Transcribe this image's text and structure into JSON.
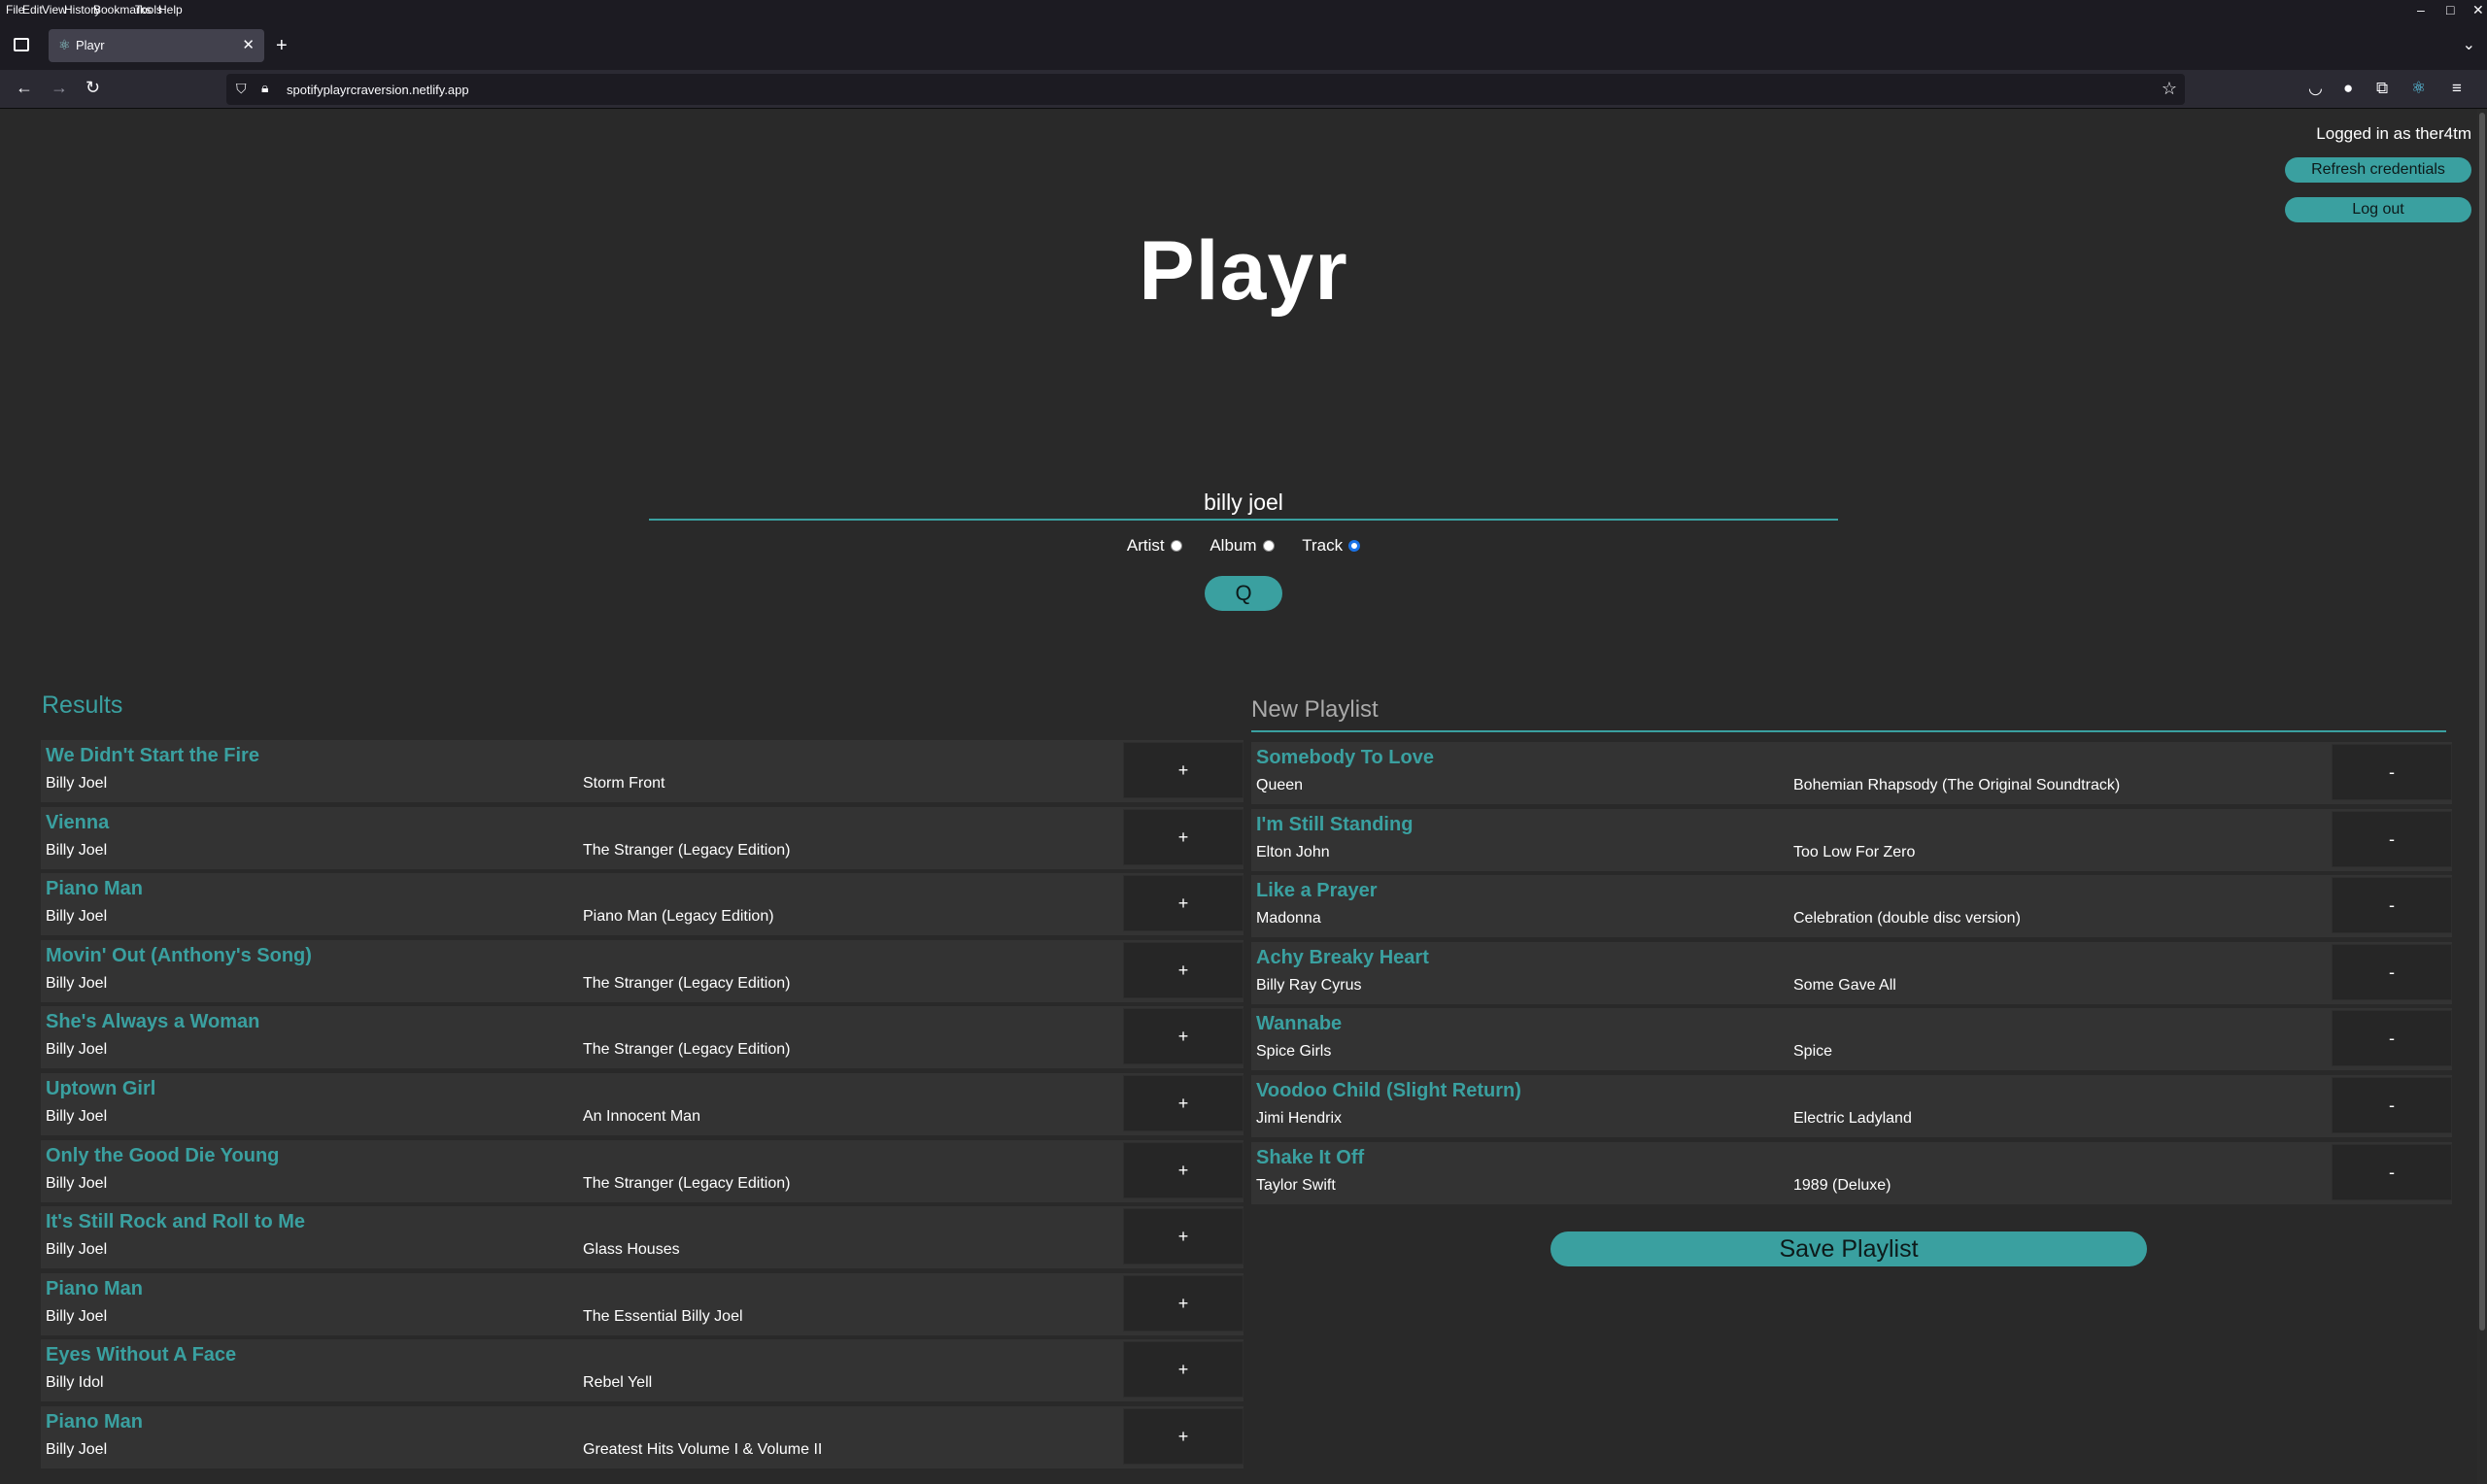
{
  "browser": {
    "menus": [
      "File",
      "Edit",
      "View",
      "History",
      "Bookmarks",
      "Tools",
      "Help"
    ],
    "tab_title": "Playr",
    "url": "spotifyplayrcraversion.netlify.app"
  },
  "header": {
    "logged_in_text": "Logged in as ther4tm",
    "refresh_label": "Refresh credentials",
    "logout_label": "Log out",
    "app_title": "Playr"
  },
  "search": {
    "value": "billy joel",
    "options": [
      {
        "label": "Artist",
        "checked": false
      },
      {
        "label": "Album",
        "checked": false
      },
      {
        "label": "Track",
        "checked": true
      }
    ],
    "button_label": "Q"
  },
  "results": {
    "title": "Results",
    "add_label": "+",
    "tracks": [
      {
        "name": "We Didn't Start the Fire",
        "artist": "Billy Joel",
        "album": "Storm Front"
      },
      {
        "name": "Vienna",
        "artist": "Billy Joel",
        "album": "The Stranger (Legacy Edition)"
      },
      {
        "name": "Piano Man",
        "artist": "Billy Joel",
        "album": "Piano Man (Legacy Edition)"
      },
      {
        "name": "Movin' Out (Anthony's Song)",
        "artist": "Billy Joel",
        "album": "The Stranger (Legacy Edition)"
      },
      {
        "name": "She's Always a Woman",
        "artist": "Billy Joel",
        "album": "The Stranger (Legacy Edition)"
      },
      {
        "name": "Uptown Girl",
        "artist": "Billy Joel",
        "album": "An Innocent Man"
      },
      {
        "name": "Only the Good Die Young",
        "artist": "Billy Joel",
        "album": "The Stranger (Legacy Edition)"
      },
      {
        "name": "It's Still Rock and Roll to Me",
        "artist": "Billy Joel",
        "album": "Glass Houses"
      },
      {
        "name": "Piano Man",
        "artist": "Billy Joel",
        "album": "The Essential Billy Joel"
      },
      {
        "name": "Eyes Without A Face",
        "artist": "Billy Idol",
        "album": "Rebel Yell"
      },
      {
        "name": "Piano Man",
        "artist": "Billy Joel",
        "album": "Greatest Hits Volume I & Volume II"
      }
    ]
  },
  "playlist": {
    "name_value": "New Playlist",
    "remove_label": "-",
    "save_label": "Save Playlist",
    "tracks": [
      {
        "name": "Somebody To Love",
        "artist": "Queen",
        "album": "Bohemian Rhapsody (The Original Soundtrack)"
      },
      {
        "name": "I'm Still Standing",
        "artist": "Elton John",
        "album": "Too Low For Zero"
      },
      {
        "name": "Like a Prayer",
        "artist": "Madonna",
        "album": "Celebration (double disc version)"
      },
      {
        "name": "Achy Breaky Heart",
        "artist": "Billy Ray Cyrus",
        "album": "Some Gave All"
      },
      {
        "name": "Wannabe",
        "artist": "Spice Girls",
        "album": "Spice"
      },
      {
        "name": "Voodoo Child (Slight Return)",
        "artist": "Jimi Hendrix",
        "album": "Electric Ladyland"
      },
      {
        "name": "Shake It Off",
        "artist": "Taylor Swift",
        "album": "1989 (Deluxe)"
      }
    ]
  },
  "colors": {
    "accent": "#3aa0a0",
    "page_bg": "#292929",
    "row_bg": "#333333"
  }
}
